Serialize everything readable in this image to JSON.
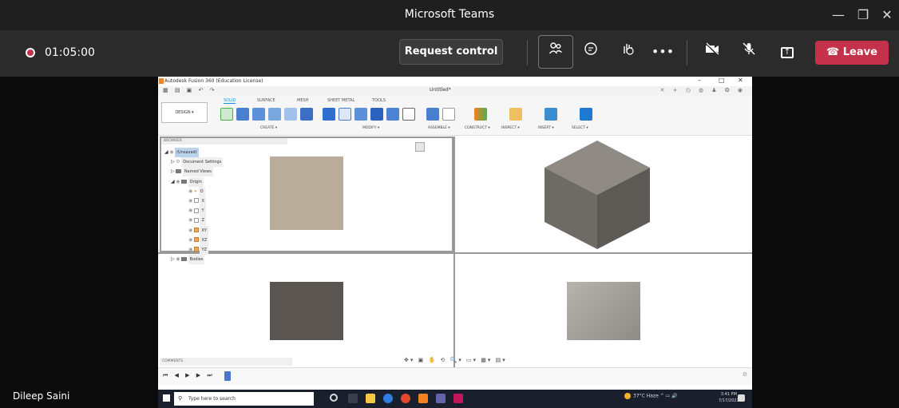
{
  "window": {
    "title": "Microsoft Teams",
    "minimize_icon": "—",
    "restore_icon": "❐",
    "close_icon": "✕"
  },
  "call": {
    "recording_time": "01:05:00",
    "request_control_label": "Request control",
    "more_icon": "•••",
    "leave_label": "Leave",
    "leave_color": "#c4314b"
  },
  "shared_screen": {
    "app_title": "Autodesk Fusion 360 (Education License)",
    "doc_title": "Untitled*",
    "window_controls": [
      "–",
      "□",
      "✕"
    ],
    "design_label": "DESIGN ▾",
    "tabs": [
      "SOLID",
      "SURFACE",
      "MESH",
      "SHEET METAL",
      "TOOLS"
    ],
    "groups": [
      "CREATE ▾",
      "MODIFY ▾",
      "ASSEMBLE ▾",
      "CONSTRUCT ▾",
      "INSPECT ▾",
      "INSERT ▾",
      "SELECT ▾"
    ],
    "browser": {
      "header": "BROWSER",
      "root": "(Unsaved)",
      "items": {
        "document_settings": "Document Settings",
        "named_views": "Named Views",
        "origin": "Origin",
        "o": "O",
        "x": "X",
        "y": "Y",
        "z": "Z",
        "xy": "XY",
        "xz": "XZ",
        "yz": "YZ",
        "bodies": "Bodies"
      }
    },
    "comments_label": "COMMENTS",
    "cube_colors": {
      "top": "#8f8a83",
      "left": "#6e6a65",
      "right": "#5d5954"
    }
  },
  "taskbar": {
    "search_placeholder": "Type here to search",
    "weather": "37°C Haze",
    "time": "3:41 PM",
    "date": "7/17/2021"
  },
  "participant": {
    "name": "Dileep Saini"
  }
}
